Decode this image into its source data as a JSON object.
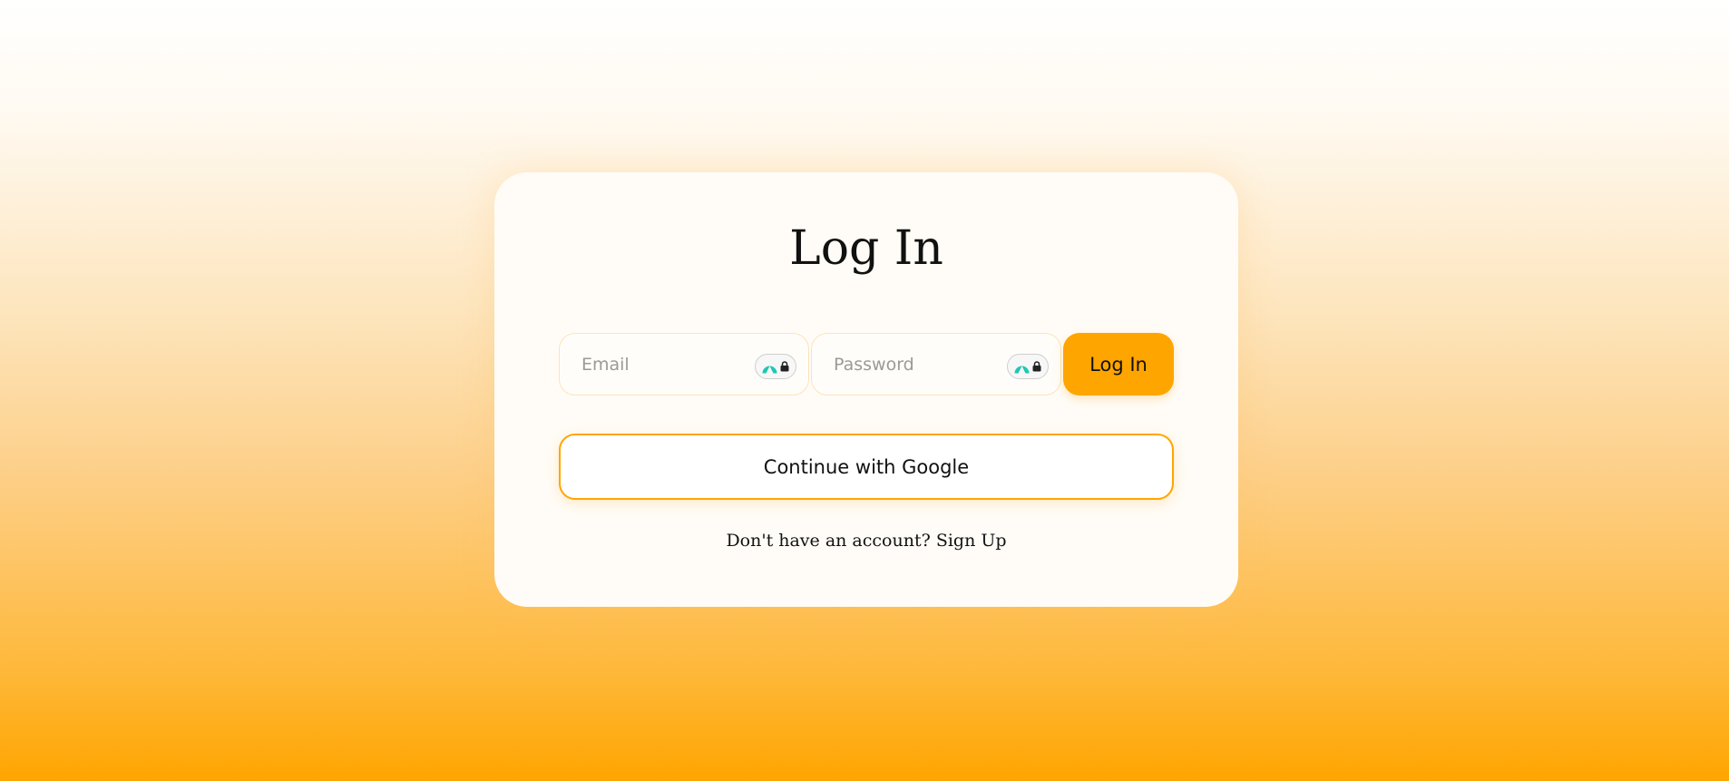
{
  "login": {
    "title": "Log In",
    "email": {
      "placeholder": "Email",
      "value": ""
    },
    "password": {
      "placeholder": "Password",
      "value": ""
    },
    "submit_label": "Log In",
    "google_label": "Continue with Google",
    "signup_prompt": "Don't have an account?",
    "signup_link_label": "Sign Up"
  },
  "colors": {
    "accent": "#ffa500",
    "card_background": "#fffcf7",
    "field_border": "#fde3bb",
    "badge_icon": "#1fc7b3"
  },
  "icons": {
    "field_badge": "password-manager-lock-icon"
  }
}
